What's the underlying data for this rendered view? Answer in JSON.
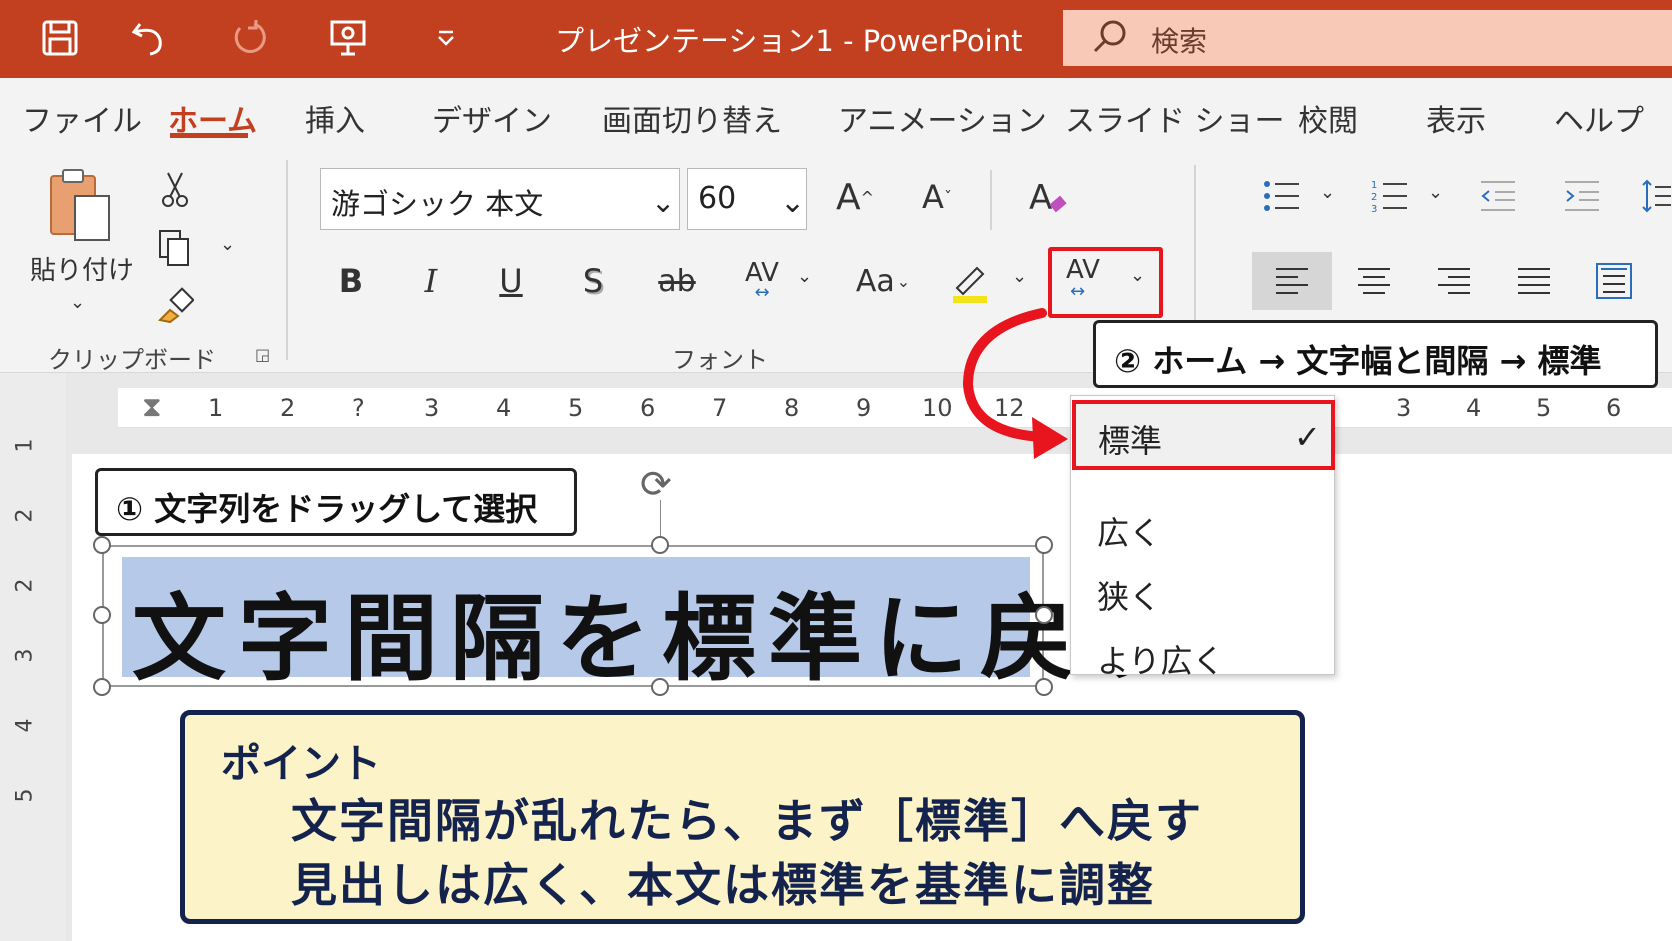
{
  "titlebar": {
    "title": "プレゼンテーション1  -  PowerPoint",
    "search_label": "検索",
    "color": "#c2401f"
  },
  "menu": {
    "tabs": [
      "ファイル",
      "ホーム",
      "挿入",
      "デザイン",
      "画面切り替え",
      "アニメーション",
      "スライド ショー",
      "校閲",
      "表示",
      "ヘルプ"
    ],
    "active": "ホーム"
  },
  "ribbon": {
    "paste_label": "貼り付け",
    "clipboard_label": "クリップボード",
    "font_group_label": "フォント",
    "font_name": "游ゴシック 本文",
    "font_size": "60",
    "grow_font": "A",
    "shrink_font": "A",
    "bold": "B",
    "italic": "I",
    "underline": "U",
    "shadow": "S",
    "strike": "ab",
    "spacing_label": "AV",
    "case_label": "Aa"
  },
  "ruler": {
    "numbers": [
      "1",
      "2",
      "?",
      "3",
      "4",
      "5",
      "6",
      "7",
      "8",
      "9",
      "10",
      "12",
      "3",
      "4",
      "5",
      "6"
    ],
    "vertical": [
      "1",
      "2",
      "2",
      "3",
      "4",
      "5"
    ]
  },
  "slide": {
    "callout1": "① 文字列をドラッグして選択",
    "selected_text": "文字間隔を標準に戻す",
    "point_title": "ポイント",
    "point_line1": "文字間隔が乱れたら、まず［標準］へ戻す",
    "point_line2": "見出しは広く、本文は標準を基準に調整"
  },
  "callout2": "② ホーム → 文字幅と間隔 → 標準",
  "dropdown": {
    "items": [
      "標準",
      "広く",
      "狭く",
      "より広く"
    ],
    "selected": "標準",
    "check": "✓"
  },
  "colors": {
    "accent_red": "#e8141e",
    "selection": "#b7c9e8",
    "point_bg": "#fcf3c8",
    "point_border": "#13234d"
  }
}
